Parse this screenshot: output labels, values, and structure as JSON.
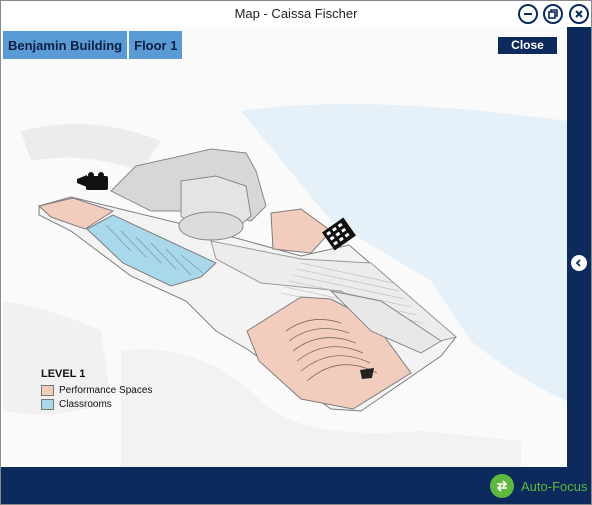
{
  "window": {
    "title": "Map - Caissa Fischer"
  },
  "breadcrumb": {
    "building": "Benjamin Building",
    "floor": "Floor 1"
  },
  "actions": {
    "close_label": "Close",
    "autofocus_label": "Auto-Focus"
  },
  "legend": {
    "title": "LEVEL 1",
    "items": [
      {
        "label": "Performance Spaces",
        "color": "#f2cdbd"
      },
      {
        "label": "Classrooms",
        "color": "#a9d8ea"
      }
    ]
  },
  "colors": {
    "accent": "#5b9bd5",
    "navy": "#0c2a5b",
    "autofocus": "#5fb83e",
    "water": "#e3eff8"
  }
}
